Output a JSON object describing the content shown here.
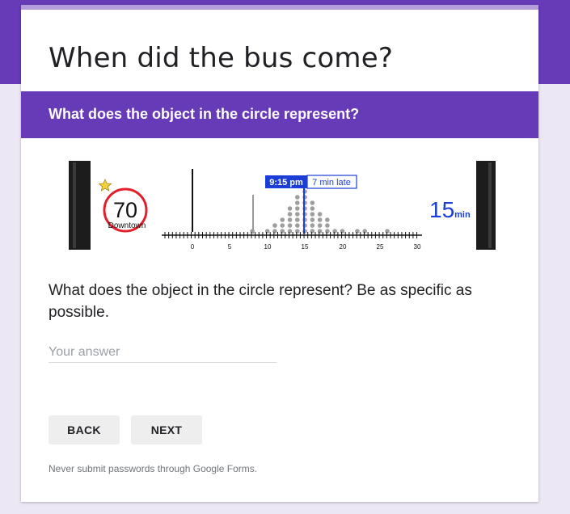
{
  "form": {
    "title": "When did the bus come?",
    "section_title": "What does the object in the circle represent?"
  },
  "figure": {
    "route_number": "70",
    "route_direction": "Downtown",
    "arrival_time": "9:15 pm",
    "late_label": "7 min late",
    "minutes_value": "15",
    "minutes_unit": "min",
    "axis_ticks": [
      "0",
      "5",
      "10",
      "15",
      "20",
      "25",
      "30"
    ],
    "colors": {
      "accent_blue": "#1a3ed6",
      "circle_red": "#e0202b",
      "dots_gray": "#9e9e9e",
      "star_yellow": "#f5d23b"
    }
  },
  "question": {
    "text": "What does the object in the circle represent? Be as specific as possible.",
    "placeholder": "Your answer",
    "value": ""
  },
  "buttons": {
    "back": "BACK",
    "next": "NEXT"
  },
  "footer": {
    "note": "Never submit passwords through Google Forms."
  }
}
